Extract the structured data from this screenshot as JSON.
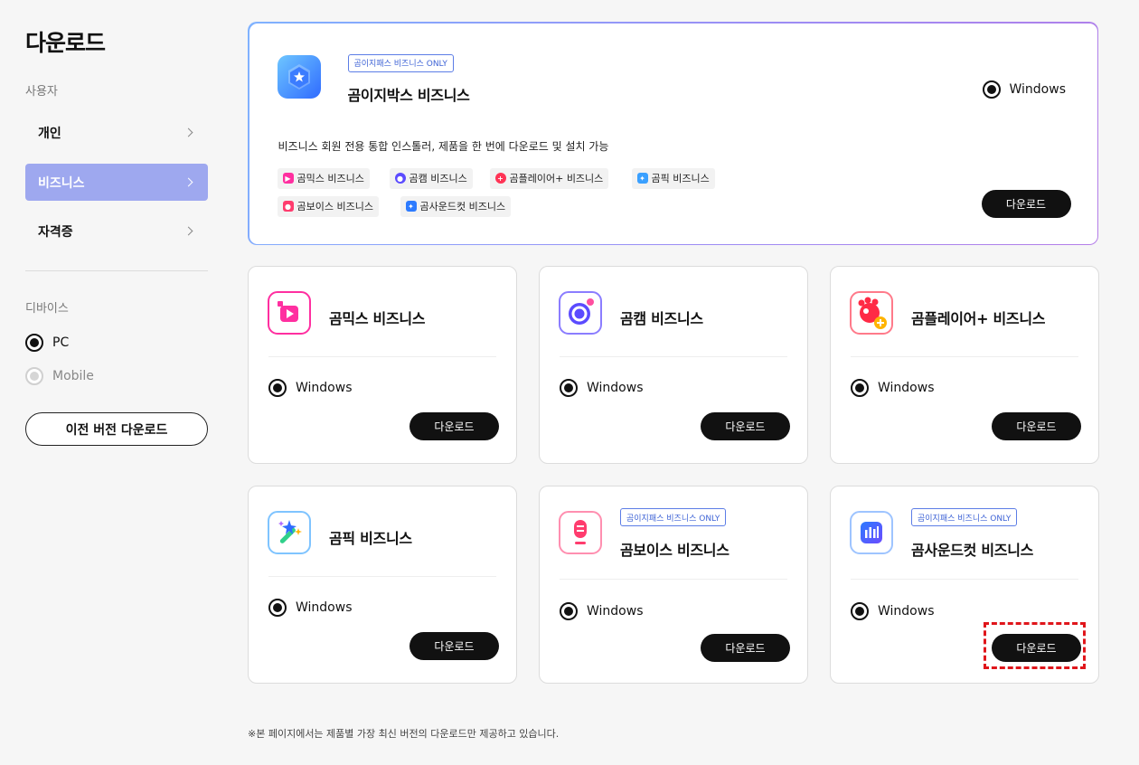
{
  "sidebar": {
    "title": "다운로드",
    "user_section": "사용자",
    "user_items": [
      {
        "label": "개인"
      },
      {
        "label": "비즈니스"
      },
      {
        "label": "자격증"
      }
    ],
    "device_section": "디바이스",
    "devices": [
      {
        "label": "PC"
      },
      {
        "label": "Mobile"
      }
    ],
    "prev_button": "이전 버전 다운로드"
  },
  "hero": {
    "badge": "곰이지패스 비즈니스 ONLY",
    "name": "곰이지박스 비즈니스",
    "os": "Windows",
    "description": "비즈니스 회원 전용 통합 인스톨러, 제품을 한 번에 다운로드 및 설치 가능",
    "chips": [
      {
        "label": "곰믹스 비즈니스",
        "icon": "gommix-icon",
        "color": "#ff2fa0"
      },
      {
        "label": "곰캠 비즈니스",
        "icon": "gomcam-icon",
        "color": "#5b4bff"
      },
      {
        "label": "곰플레이어+ 비즈니스",
        "icon": "gomplayer-icon",
        "color": "#ff3355"
      },
      {
        "label": "곰픽 비즈니스",
        "icon": "gompic-icon",
        "color": "#3aa0ff"
      },
      {
        "label": "곰보이스 비즈니스",
        "icon": "gomvoice-icon",
        "color": "#ff3c6e"
      },
      {
        "label": "곰사운드컷 비즈니스",
        "icon": "gomsoundcut-icon",
        "color": "#2d7bff"
      }
    ],
    "download": "다운로드"
  },
  "cards": [
    {
      "name": "곰믹스 비즈니스",
      "badge": "",
      "os": "Windows",
      "download": "다운로드",
      "icon": "gommix-icon"
    },
    {
      "name": "곰캠 비즈니스",
      "badge": "",
      "os": "Windows",
      "download": "다운로드",
      "icon": "gomcam-icon"
    },
    {
      "name": "곰플레이어+ 비즈니스",
      "badge": "",
      "os": "Windows",
      "download": "다운로드",
      "icon": "gomplayer-icon"
    },
    {
      "name": "곰픽 비즈니스",
      "badge": "",
      "os": "Windows",
      "download": "다운로드",
      "icon": "gompic-icon"
    },
    {
      "name": "곰보이스 비즈니스",
      "badge": "곰이지패스 비즈니스 ONLY",
      "os": "Windows",
      "download": "다운로드",
      "icon": "gomvoice-icon"
    },
    {
      "name": "곰사운드컷 비즈니스",
      "badge": "곰이지패스 비즈니스 ONLY",
      "os": "Windows",
      "download": "다운로드",
      "icon": "gomsoundcut-icon"
    }
  ],
  "footnote": "※본 페이지에서는 제품별 가장 최신 버전의 다운로드만 제공하고 있습니다.",
  "colors": {
    "active_menu": "#9ea8ef",
    "badge_blue": "#3f64d6",
    "button": "#111111",
    "highlight": "#e0161b"
  }
}
